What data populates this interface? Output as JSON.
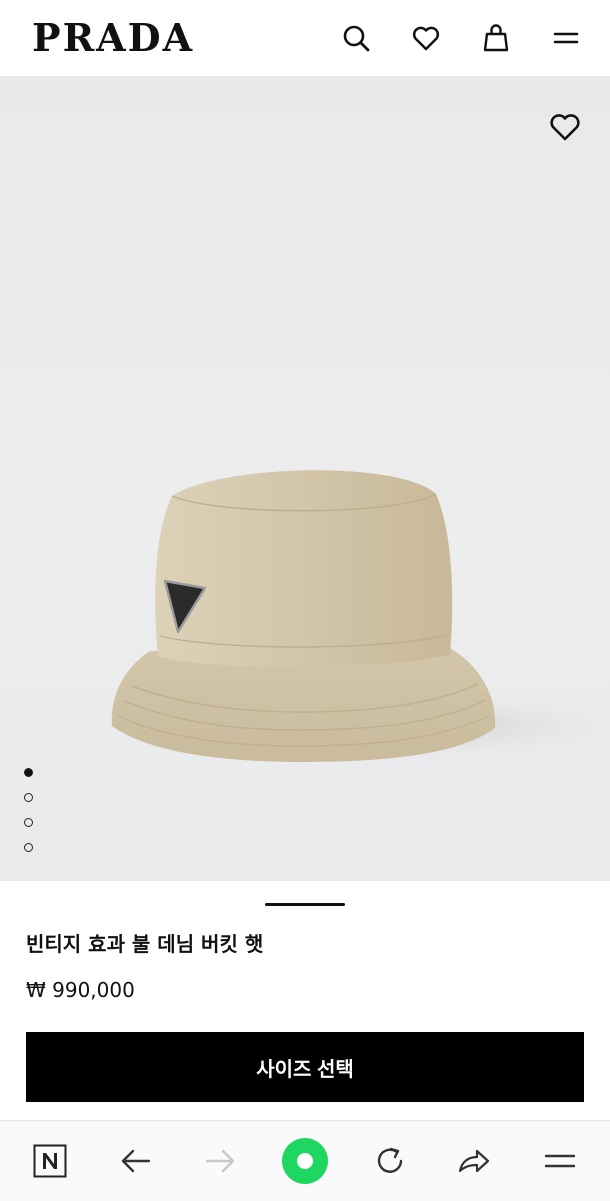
{
  "header": {
    "logo": "PRADA",
    "icons": [
      "search-icon",
      "heart-icon",
      "shopping-bag-icon",
      "menu-icon"
    ]
  },
  "gallery": {
    "image_count": 4,
    "active_index": 0
  },
  "product": {
    "title": "빈티지 효과 불 데님 버킷 햇",
    "price": "₩ 990,000",
    "cta_label": "사이즈 선택"
  },
  "browser_nav": {
    "icons": [
      "naver-n-icon",
      "back-arrow-icon",
      "forward-arrow-icon",
      "home-green-dot-icon",
      "refresh-icon",
      "share-icon",
      "menu-icon"
    ]
  },
  "colors": {
    "accent_green": "#1ed760",
    "cta_bg": "#000000"
  }
}
